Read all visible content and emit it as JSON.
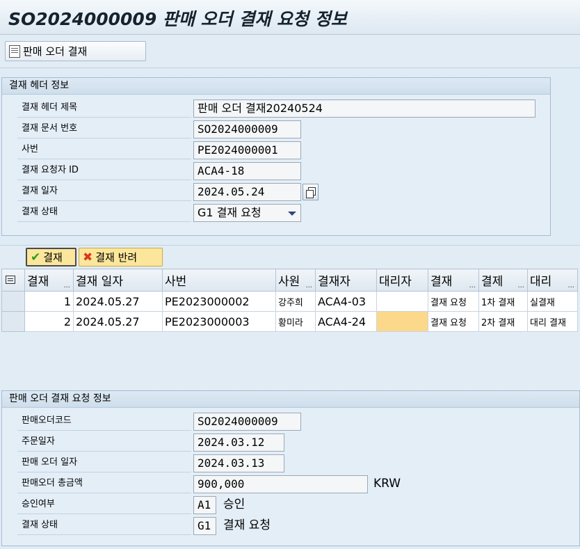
{
  "window": {
    "title": "SO2024000009 판매 오더 결재 요청 정보"
  },
  "toolbar": {
    "button_label": "판매 오더 결재"
  },
  "header_group": {
    "title": "결재 헤더 정보",
    "fields": [
      {
        "label": "결재 헤더 제목",
        "value": "판매 오더 결재20240524"
      },
      {
        "label": "결재 문서 번호",
        "value": "SO2024000009"
      },
      {
        "label": "사번",
        "value": "PE2024000001"
      },
      {
        "label": "결재 요청자 ID",
        "value": "ACA4-18"
      },
      {
        "label": "결재 일자",
        "value": "2024.05.24"
      },
      {
        "label": "결재 상태",
        "value": "G1 결재 요청"
      }
    ]
  },
  "approval_grid": {
    "approve_label": "결재",
    "reject_label": "결재 반려",
    "columns": [
      "결재",
      "결재 일자",
      "사번",
      "사원",
      "결재자",
      "대리자",
      "결재",
      "결제",
      "대리"
    ],
    "rows": [
      [
        "1",
        "2024.05.27",
        "PE2023000002",
        "강주희",
        "ACA4-03",
        "",
        "결재 요청",
        "1차 결재",
        "실결재"
      ],
      [
        "2",
        "2024.05.27",
        "PE2023000003",
        "황미라",
        "ACA4-24",
        "",
        "결재 요청",
        "2차 결재",
        "대리 결재"
      ]
    ]
  },
  "order_group": {
    "title": "판매 오더 결재 요청 정보",
    "fields": [
      {
        "label": "판매오더코드",
        "value": "SO2024000009"
      },
      {
        "label": "주문일자",
        "value": "2024.03.12"
      },
      {
        "label": "판매 오더 일자",
        "value": "2024.03.13"
      },
      {
        "label": "판매오더 총금액",
        "value": "900,000",
        "unit": "KRW"
      },
      {
        "label": "승인여부",
        "value": "A1",
        "desc": "승인"
      },
      {
        "label": "결재 상태",
        "value": "G1",
        "desc": "결재 요청"
      }
    ]
  }
}
